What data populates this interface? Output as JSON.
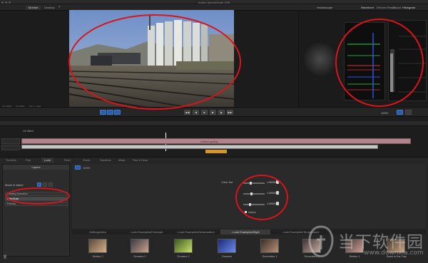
{
  "window": {
    "title": "Adobe SpeedGrade CS6"
  },
  "top_tabs": [
    "Monitor",
    "Desktop"
  ],
  "scopes": {
    "vectorscope": "Vectorscope",
    "waveform": "Waveform",
    "render_result": "Render Result",
    "output": "Output",
    "histogram": "Histogram"
  },
  "viewer": {
    "fps_readout": "30 FPS",
    "fps_field": "30 FPS",
    "resolution": "720 x 406"
  },
  "transport": {
    "zoom": "100%"
  },
  "timeline": {
    "track_text": "Untitled grading",
    "marker_label": "Un titled"
  },
  "bottom_tabs": [
    "Timeline",
    "Pan",
    "Look",
    "Pixel",
    "Shots",
    "Sandbox",
    "Mask",
    "Pan & Scan"
  ],
  "layers": {
    "header": "Layers",
    "mode_label": "Mode & Name",
    "items": [
      {
        "name": "Grading Operation",
        "selected": false
      },
      {
        "name": "FilterGrain",
        "selected": true
      },
      {
        "name": "Primary",
        "selected": false
      }
    ]
  },
  "effect": {
    "zoom": "100%",
    "controls": [
      {
        "label": "Color tint",
        "value": "1.00000",
        "level": 0.32
      },
      {
        "label": "",
        "value": "1.00000",
        "level": 0.35
      },
      {
        "label": "",
        "value": "1.00000",
        "level": 0.3
      }
    ],
    "clamp_label": "clamp"
  },
  "looks": {
    "tabs": [
      "..Settings\\Idea",
      "..Look Examples\\Cinestyle",
      "..Look Examples\\Desaturation",
      "..Look Examples\\Style",
      "..Look Examples\\Temperature"
    ],
    "active_tab": 3,
    "items": [
      "Sixties 2",
      "Dreams 1",
      "Dreams 2",
      "Dreams",
      "Seventies 1",
      "Seventies 2",
      "Sixties 1",
      "Back in the Day"
    ]
  },
  "watermark": {
    "text": "当下软件园",
    "url": "www.downxia.com"
  },
  "colors": {
    "highlight": "#d9141b",
    "accent": "#2a5fa8",
    "track": "#b0848a"
  },
  "icons": [
    "close-icon",
    "minimize-icon",
    "zoom-icon",
    "play-icon",
    "stop-icon",
    "rewind-icon",
    "forward-icon",
    "eye-icon",
    "lock-icon",
    "trash-icon"
  ]
}
